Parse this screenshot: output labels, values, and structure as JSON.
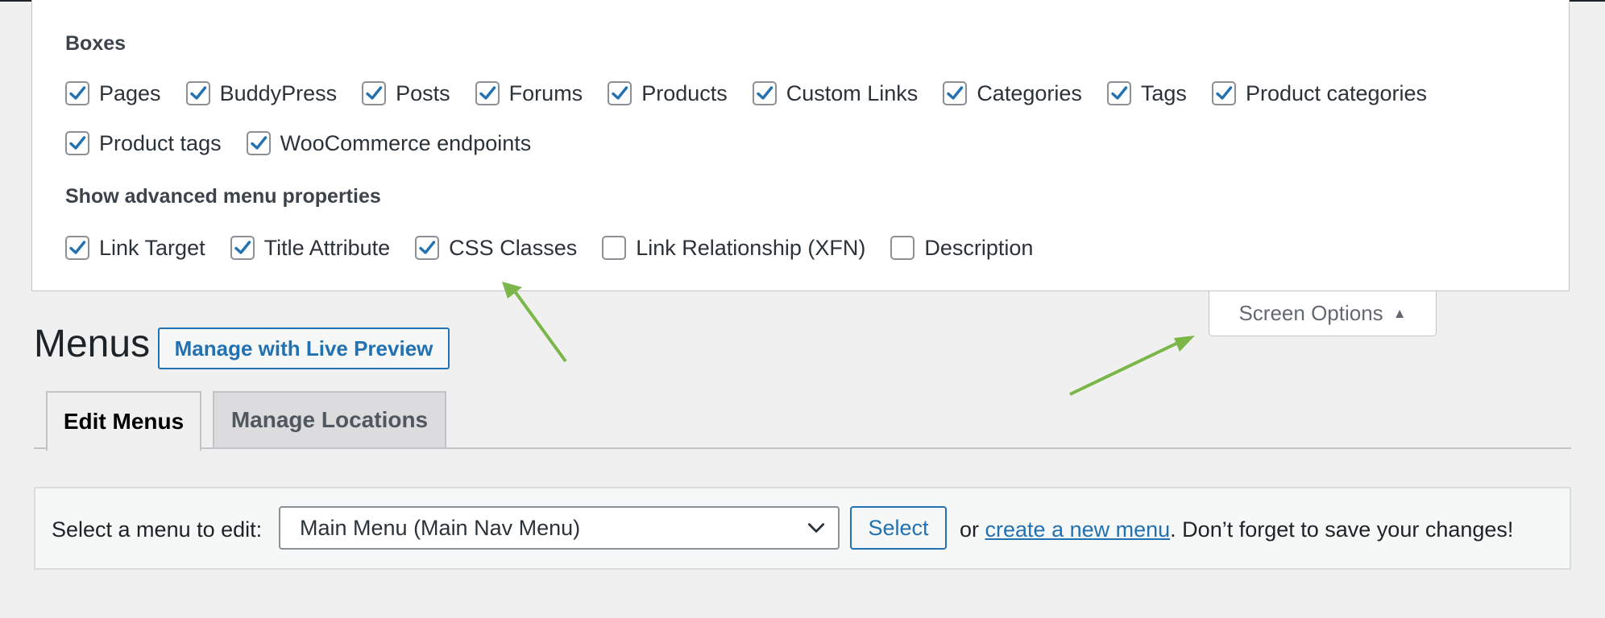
{
  "screen_options": {
    "boxes_heading": "Boxes",
    "boxes": [
      {
        "label": "Pages",
        "checked": true
      },
      {
        "label": "BuddyPress",
        "checked": true
      },
      {
        "label": "Posts",
        "checked": true
      },
      {
        "label": "Forums",
        "checked": true
      },
      {
        "label": "Products",
        "checked": true
      },
      {
        "label": "Custom Links",
        "checked": true
      },
      {
        "label": "Categories",
        "checked": true
      },
      {
        "label": "Tags",
        "checked": true
      },
      {
        "label": "Product categories",
        "checked": true
      },
      {
        "label": "Product tags",
        "checked": true
      },
      {
        "label": "WooCommerce endpoints",
        "checked": true
      }
    ],
    "advanced_heading": "Show advanced menu properties",
    "advanced": [
      {
        "label": "Link Target",
        "checked": true
      },
      {
        "label": "Title Attribute",
        "checked": true
      },
      {
        "label": "CSS Classes",
        "checked": true
      },
      {
        "label": "Link Relationship (XFN)",
        "checked": false
      },
      {
        "label": "Description",
        "checked": false
      }
    ],
    "tab_label": "Screen Options"
  },
  "header": {
    "title": "Menus",
    "live_preview_label": "Manage with Live Preview"
  },
  "tabs": [
    {
      "label": "Edit Menus",
      "active": true
    },
    {
      "label": "Manage Locations",
      "active": false
    }
  ],
  "manage": {
    "label": "Select a menu to edit:",
    "selected_menu": "Main Menu (Main Nav Menu)",
    "select_button": "Select",
    "or_text": "or",
    "create_link": "create a new menu",
    "save_hint": ". Don’t forget to save your changes!"
  },
  "colors": {
    "accent": "#2271b1",
    "check": "#2271b1",
    "annotation_arrow": "#7ab648"
  },
  "icons": {
    "checkbox": "checkmark-icon",
    "dropdown": "chevron-down-icon",
    "screen_options_toggle": "triangle-up-icon"
  }
}
